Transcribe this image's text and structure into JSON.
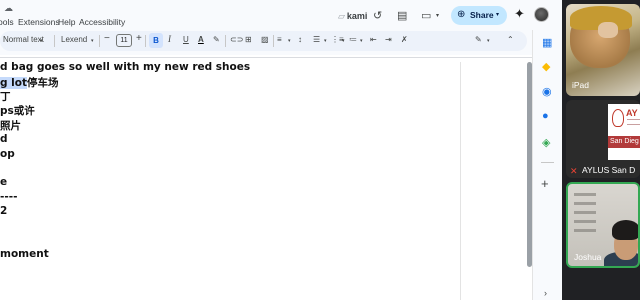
{
  "docs": {
    "menu": {
      "tools": "ools",
      "extensions": "Extensions",
      "help": "Help",
      "accessibility": "Accessibility"
    },
    "top_icon_glyph": "☁",
    "kami": {
      "logo_glyph": "▱",
      "label": "kami"
    },
    "top_icons": {
      "history": "↺",
      "comment": "▤",
      "meet": "▭",
      "meet_caret": "▾"
    },
    "share": {
      "globe": "⊕",
      "label": "Share",
      "caret": "▾"
    },
    "gemini_glyph": "✦",
    "toolbar": {
      "style": "Normal text",
      "font": "Lexend",
      "size_minus": "−",
      "size": "11",
      "size_plus": "+",
      "bold": "B",
      "italic": "I",
      "underline": "U",
      "text_color": "A",
      "highlight": "✎",
      "link": "⊂⊃",
      "comment": "⊞",
      "image": "▨",
      "align": "≡",
      "spacing": "↕",
      "checklist": "☰",
      "bullets": "⋮≡",
      "numbered": "≔",
      "indent_less": "⇤",
      "indent_more": "⇥",
      "clear_format": "✗",
      "edit_mode": "✎",
      "collapse": "⌃",
      "caret": "▾"
    },
    "document_lines": [
      "d bag goes so well with my new red shoes",
      {
        "selected": "g lot",
        "rest": "停车场"
      },
      "丁",
      "ps或许",
      "照片",
      "d",
      "op",
      "",
      "e",
      "----",
      "2",
      "",
      "",
      "moment",
      ""
    ],
    "side_panel": {
      "calendar": "▦",
      "keep": "◆",
      "tasks": "◉",
      "contacts": "●",
      "maps": "◈",
      "addon": "+",
      "expand": "›"
    }
  },
  "meet": {
    "tiles": [
      {
        "label": "iPad"
      },
      {
        "label": "AYLUS San D",
        "logo_text": "AY",
        "banner_text": "San Dieg",
        "mute_icon": "✕"
      },
      {
        "label": "Joshua"
      }
    ]
  }
}
